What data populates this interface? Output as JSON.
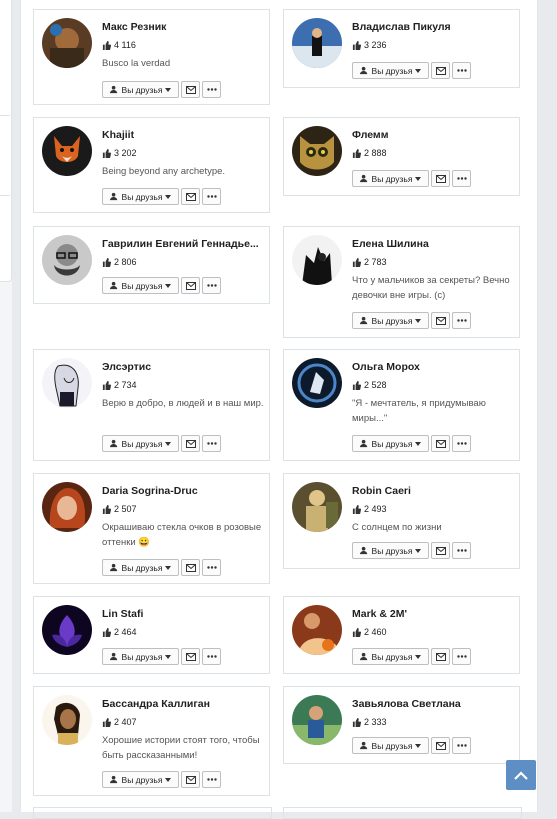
{
  "buttons": {
    "friends_label": "Вы друзья",
    "message_icon": "envelope-icon",
    "more_icon": "ellipsis-icon"
  },
  "cards": [
    {
      "name": "Макс Резник",
      "likes": "4 116",
      "status": "Busco la verdad",
      "avatar_color": "#6b4a2e"
    },
    {
      "name": "Владислав Пикуля",
      "likes": "3 236",
      "status": "",
      "avatar_color": "#4d7fb8"
    },
    {
      "name": "Khajiit",
      "likes": "3 202",
      "status": "Being beyond any archetype.",
      "avatar_color": "#d45f1e"
    },
    {
      "name": "Флемм",
      "likes": "2 888",
      "status": "",
      "avatar_color": "#b08a3a"
    },
    {
      "name": "Гаврилин Евгений Геннадье...",
      "likes": "2 806",
      "status": "",
      "avatar_color": "#8a8a8a"
    },
    {
      "name": "Елена Шилина",
      "likes": "2 783",
      "status": "Что у мальчиков за секреты? Вечно девочки вне игры. (с)",
      "avatar_color": "#222222"
    },
    {
      "name": "Элсэртис",
      "likes": "2 734",
      "status": "Верю в добро, в людей и в наш мир.",
      "avatar_color": "#c9c9d6"
    },
    {
      "name": "Ольга Морох",
      "likes": "2 528",
      "status": "\"Я - мечтатель, я придумываю миры...\"",
      "avatar_color": "#1b2f4a"
    },
    {
      "name": "Daria Sogrina-Druc",
      "likes": "2 507",
      "status": "Окрашиваю стекла очков в розовые оттенки 😀",
      "avatar_color": "#8a3a1e"
    },
    {
      "name": "Robin Caeri",
      "likes": "2 493",
      "status": "С солнцем по жизни",
      "avatar_color": "#c9b073"
    },
    {
      "name": "Lin Stafi",
      "likes": "2 464",
      "status": "",
      "avatar_color": "#4b2a8a"
    },
    {
      "name": "Mark & 2M'",
      "likes": "2 460",
      "status": "",
      "avatar_color": "#a5562a"
    },
    {
      "name": "Бассандра Каллиган",
      "likes": "2 407",
      "status": "Хорошие истории стоят того, чтобы быть рассказанными!",
      "avatar_color": "#6b4b2e"
    },
    {
      "name": "Завьялова Светлана",
      "likes": "2 333",
      "status": "",
      "avatar_color": "#3a7a4a"
    }
  ]
}
